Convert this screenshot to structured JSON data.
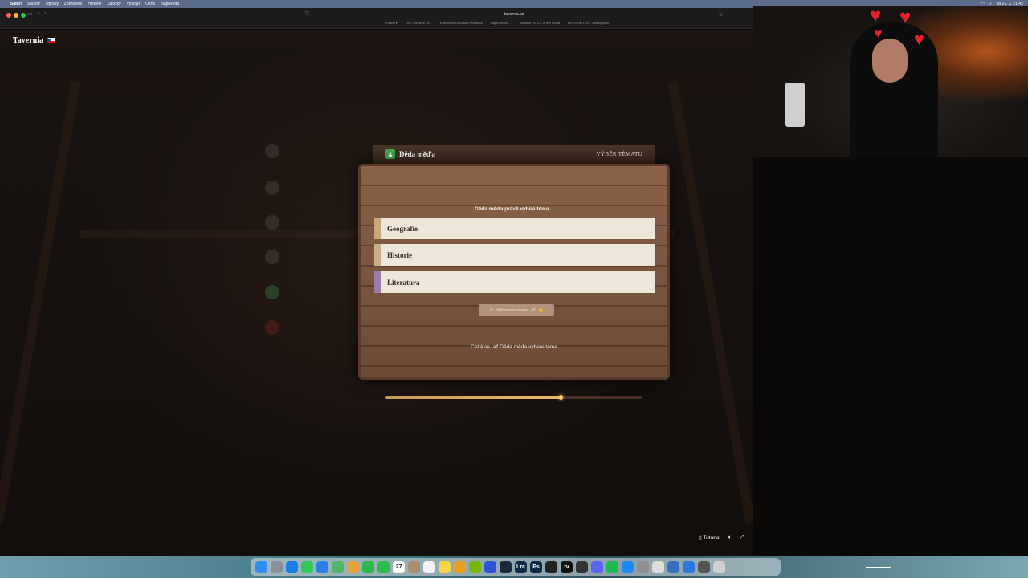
{
  "menubar": {
    "app": "Safari",
    "items": [
      "Soubor",
      "Úpravy",
      "Zobrazení",
      "Historie",
      "Záložky",
      "Vývojář",
      "Okno",
      "Nápověda"
    ],
    "clock": "so 27. 3.  21:42"
  },
  "browser": {
    "url": "tavernia.cz",
    "bookmarks": [
      "Forum ▾",
      "The True Bee Of...",
      "ExtensionsGoodBio Feedback",
      "https://token...",
      "Shadow PC Cl...in the Cloud",
      "DISTURB FOR...actionphoto"
    ]
  },
  "game": {
    "brand": "Tavernia",
    "modal": {
      "player_name": "Děda měďa",
      "header_right": "VÝBĚR TÉMATU",
      "prompt": "Děda měďa právě vybírá téma...",
      "topics": [
        {
          "label": "Geografie",
          "color": "#c9a879"
        },
        {
          "label": "Historie",
          "color": "#c8b08a"
        },
        {
          "label": "Literatura",
          "color": "#9a7ba8"
        }
      ],
      "reroll_label": "Vylosovat znovu",
      "reroll_cost": "-20",
      "waiting_text": "Čeká se, až Děda měďa vybere téma",
      "timer_progress": 0.68
    },
    "footer": {
      "tutorial_label": "Tutorial"
    }
  },
  "dock": {
    "date_day": "27",
    "apps": [
      {
        "name": "finder",
        "color": "#2f8ef0",
        "glyph": ""
      },
      {
        "name": "launchpad",
        "color": "#8b8f97",
        "glyph": ""
      },
      {
        "name": "safari",
        "color": "#1e7de6",
        "glyph": ""
      },
      {
        "name": "messages",
        "color": "#34c759",
        "glyph": ""
      },
      {
        "name": "mail",
        "color": "#2a7ee5",
        "glyph": ""
      },
      {
        "name": "maps",
        "color": "#55b26a",
        "glyph": ""
      },
      {
        "name": "photos",
        "color": "#e8a13c",
        "glyph": ""
      },
      {
        "name": "facetime",
        "color": "#2eb84b",
        "glyph": ""
      },
      {
        "name": "phone",
        "color": "#30b94f",
        "glyph": ""
      }
    ],
    "apps2": [
      {
        "name": "contacts",
        "color": "#a88e6c",
        "glyph": ""
      },
      {
        "name": "reminders",
        "color": "#f2f2f2",
        "glyph": ""
      },
      {
        "name": "notes",
        "color": "#f5d547",
        "glyph": ""
      },
      {
        "name": "game-app",
        "color": "#e8a11f",
        "glyph": ""
      },
      {
        "name": "nvidia",
        "color": "#76b900",
        "glyph": ""
      },
      {
        "name": "browser-app",
        "color": "#2e52d8",
        "glyph": ""
      },
      {
        "name": "steam",
        "color": "#1b2838",
        "glyph": ""
      },
      {
        "name": "lightroom",
        "color": "#0d2d47",
        "glyph": "Lrc"
      },
      {
        "name": "photoshop",
        "color": "#0c2a46",
        "glyph": "Ps"
      },
      {
        "name": "chatgpt",
        "color": "#222",
        "glyph": ""
      },
      {
        "name": "appletv",
        "color": "#111",
        "glyph": "tv"
      },
      {
        "name": "obs",
        "color": "#333",
        "glyph": ""
      },
      {
        "name": "discord",
        "color": "#5865f2",
        "glyph": ""
      },
      {
        "name": "spotify",
        "color": "#1db954",
        "glyph": ""
      },
      {
        "name": "appstore",
        "color": "#1d8af2",
        "glyph": ""
      },
      {
        "name": "settings",
        "color": "#8e8e93",
        "glyph": ""
      },
      {
        "name": "preview",
        "color": "#dcdcdc",
        "glyph": ""
      },
      {
        "name": "finder2",
        "color": "#3a6fbf",
        "glyph": ""
      },
      {
        "name": "utility",
        "color": "#2a78e0",
        "glyph": ""
      },
      {
        "name": "downloads",
        "color": "#555",
        "glyph": ""
      },
      {
        "name": "trash",
        "color": "#d0d0d0",
        "glyph": ""
      }
    ]
  }
}
